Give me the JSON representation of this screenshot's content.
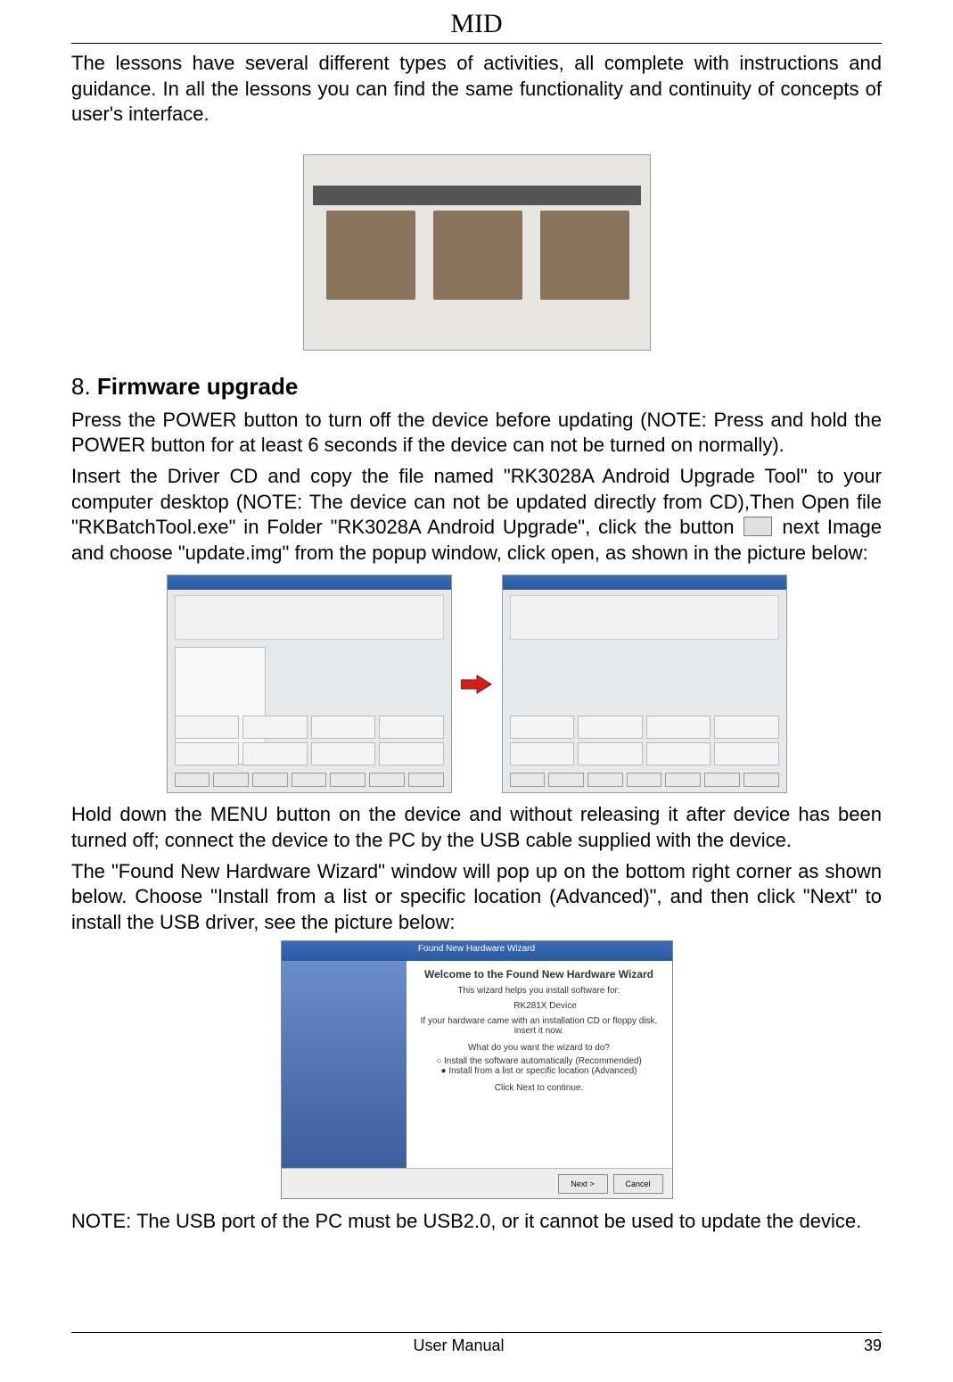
{
  "header": {
    "title": "MID"
  },
  "body": {
    "para1": "The lessons have several different types of activities, all complete with instructions and guidance. In all the lessons you can find the same functionality and continuity of concepts of user's interface.",
    "section_number": "8.",
    "section_title": "Firmware upgrade",
    "para2a": "Press the POWER button to turn off the device before updating (NOTE: Press and hold the POWER button for at least 6 seconds if the device can not be turned on normally).",
    "para2b_pre": "Insert the Driver CD and copy the file named \"RK3028A Android Upgrade Tool\" to your computer desktop (NOTE: The device can not be updated directly from CD),Then Open file \"RKBatchTool.exe\" in Folder \"RK3028A Android Upgrade\", click the button ",
    "para2b_post": " next Image and choose \"update.img\" from the popup window, click open, as shown in the picture below:",
    "para3": "Hold down the MENU button on the device and without releasing it after device has been turned off; connect the device to the PC by the USB cable supplied with the device.",
    "para4": "The \"Found New Hardware Wizard\" window will pop up on the bottom right corner as shown below. Choose \"Install from a list or specific location (Advanced)\", and then click \"Next\" to install the USB driver, see the picture below:",
    "para5": "NOTE: The USB port of the PC must be USB2.0, or it cannot be used to update the device."
  },
  "wizard": {
    "titlebar": "Found New Hardware Wizard",
    "heading": "Welcome to the Found New Hardware Wizard",
    "line1": "This wizard helps you install software for:",
    "device": "RK281X Device",
    "hint": "If your hardware came with an installation CD or floppy disk, insert it now.",
    "prompt": "What do you want the wizard to do?",
    "opt1": "Install the software automatically (Recommended)",
    "opt2": "Install from a list or specific location (Advanced)",
    "continue": "Click Next to continue.",
    "btn_next": "Next >",
    "btn_cancel": "Cancel"
  },
  "footer": {
    "center": "User Manual",
    "page": "39"
  }
}
